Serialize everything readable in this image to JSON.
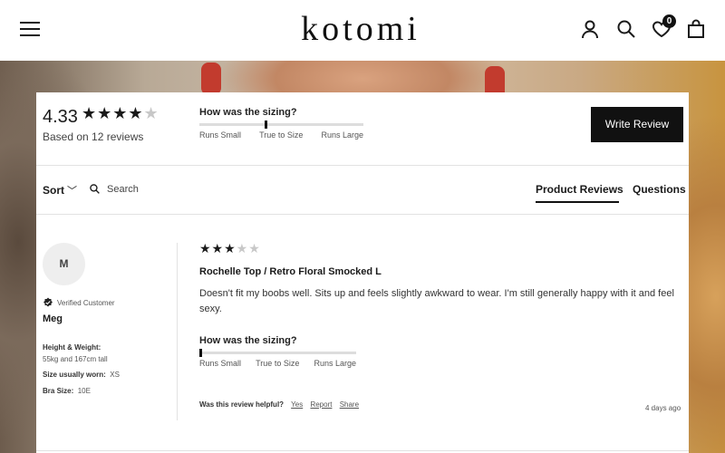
{
  "header": {
    "logo": "kotomi",
    "cart_count": "0"
  },
  "icons": {
    "menu": "hamburger-menu-icon",
    "account": "user-icon",
    "search": "search-icon",
    "wishlist": "heart-icon",
    "cart": "shopping-bag-icon"
  },
  "summary": {
    "average": "4.33",
    "stars": "★★★★",
    "stars_partial": "★",
    "based_on": "Based on 12 reviews",
    "sizing_title": "How was the sizing?",
    "sizing_labels": [
      "Runs Small",
      "True to Size",
      "Runs Large"
    ],
    "sizing_value": 0.4,
    "write_review": "Write Review"
  },
  "toolbar": {
    "sort_label": "Sort",
    "search_placeholder": "Search",
    "tabs": [
      "Product Reviews",
      "Questions"
    ]
  },
  "review": {
    "initial": "M",
    "verified": "Verified Customer",
    "name": "Meg",
    "height_weight_label": "Height & Weight:",
    "height_weight_value": "55kg and 167cm tall",
    "size_label": "Size usually worn:",
    "size_value": "XS",
    "bra_label": "Bra Size:",
    "bra_value": "10E",
    "stars_filled": "★★★",
    "stars_empty": "★★",
    "rating": 3,
    "title": "Rochelle Top / Retro Floral Smocked L",
    "body": "Doesn't fit my boobs well. Sits up and feels slightly awkward to wear. I'm still generally happy with it and feel sexy.",
    "sizing_title": "How was the sizing?",
    "sizing_labels": [
      "Runs Small",
      "True to Size",
      "Runs Large"
    ],
    "sizing_value": 0.0,
    "helpful_label": "Was this review helpful?",
    "helpful_yes": "Yes",
    "report": "Report",
    "share": "Share",
    "date": "4 days ago"
  },
  "colors": {
    "accent": "#111111",
    "star_empty": "#c8c8c8"
  }
}
